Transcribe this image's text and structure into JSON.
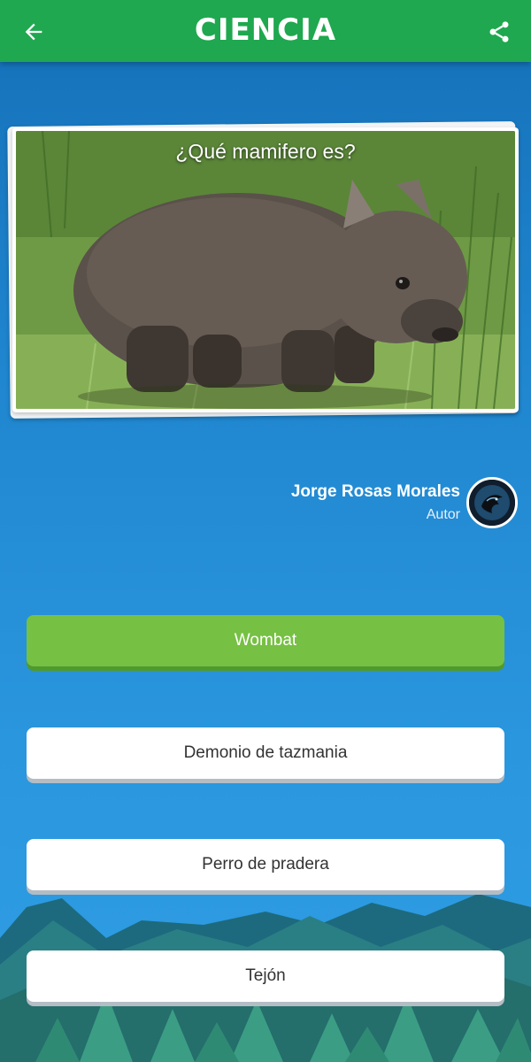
{
  "header": {
    "title": "CIENCIA",
    "back_icon": "arrow-left-icon",
    "share_icon": "share-icon",
    "color": "#1fa84f"
  },
  "question": {
    "text": "¿Qué mamifero es?",
    "image_icon": "wombat-photo"
  },
  "author": {
    "name": "Jorge Rosas Morales",
    "role": "Autor",
    "avatar_icon": "dragon-avatar"
  },
  "answers": [
    {
      "label": "Wombat",
      "state": "correct",
      "color": "#76c043"
    },
    {
      "label": "Demonio de tazmania",
      "state": "normal"
    },
    {
      "label": "Perro de pradera",
      "state": "normal"
    },
    {
      "label": "Tejón",
      "state": "normal"
    }
  ]
}
